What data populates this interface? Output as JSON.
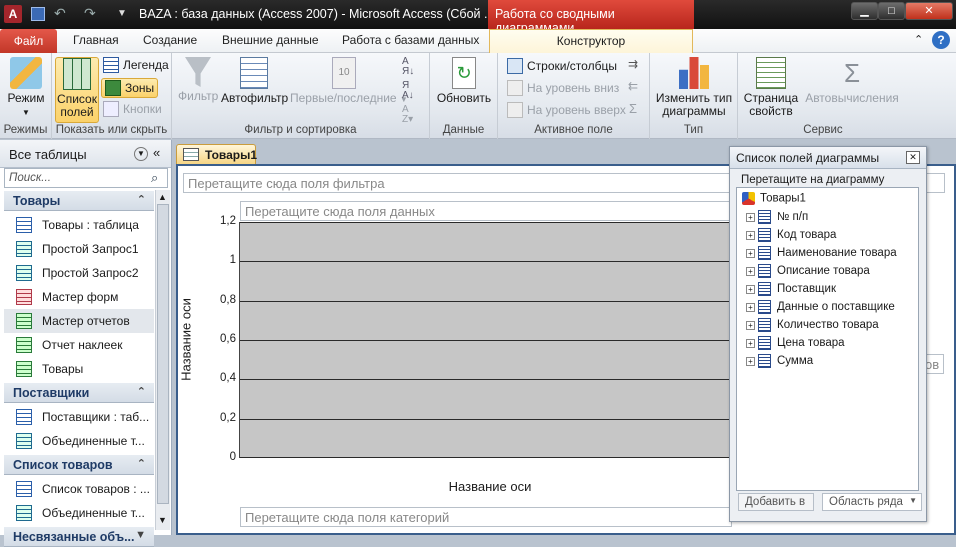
{
  "window": {
    "title": "BAZA : база данных (Access 2007)  -  Microsoft Access (Сбой ...",
    "context_tab": "Работа со сводными диаграммами",
    "min": "▁",
    "max": "□",
    "close": "✕"
  },
  "tabs": {
    "file": "Файл",
    "items": [
      "Главная",
      "Создание",
      "Внешние данные",
      "Работа с базами данных"
    ],
    "active": "Конструктор"
  },
  "ribbon": {
    "modes": {
      "label": "Режимы",
      "btn": "Режим"
    },
    "show": {
      "label": "Показать или скрыть",
      "btn1": "Список",
      "btn2": "полей",
      "legend": "Легенда",
      "zones": "Зоны",
      "buttons": "Кнопки"
    },
    "filter": {
      "label": "Фильтр и сортировка",
      "filter": "Фильтр",
      "autofilter": "Автофильтр",
      "top": "Первые/последние"
    },
    "data": {
      "label": "Данные",
      "refresh": "Обновить"
    },
    "field": {
      "label": "Активное поле",
      "rowscols": "Строки/столбцы",
      "down": "На уровень вниз",
      "up": "На уровень вверх"
    },
    "type": {
      "label": "Тип",
      "btn1": "Изменить тип",
      "btn2": "диаграммы"
    },
    "service": {
      "label": "Сервис",
      "props1": "Страница",
      "props2": "свойств",
      "autocalc": "Автовычисления"
    }
  },
  "nav": {
    "header": "Все таблицы",
    "search_placeholder": "Поиск...",
    "groups": [
      {
        "title": "Товары",
        "items": [
          "Товары : таблица",
          "Простой Запрос1",
          "Простой Запрос2",
          "Мастер форм",
          "Мастер отчетов",
          "Отчет наклеек",
          "Товары"
        ]
      },
      {
        "title": "Поставщики",
        "items": [
          "Поставщики : таб...",
          "Объединенные т..."
        ]
      },
      {
        "title": "Список товаров",
        "items": [
          "Список товаров : ...",
          "Объединенные т..."
        ]
      },
      {
        "title": "Несвязанные объ..."
      }
    ]
  },
  "document": {
    "tab": "Товары1",
    "filter_drop": "Перетащите сюда поля фильтра",
    "data_drop": "Перетащите сюда поля данных",
    "category_drop": "Перетащите сюда поля категорий",
    "series_drop_fragment": "ов"
  },
  "chart_data": {
    "type": "bar",
    "categories": [],
    "series": [],
    "xlabel": "Название оси",
    "ylabel": "Название оси",
    "ylim": [
      0,
      1.2
    ],
    "yticks": [
      "0",
      "0,2",
      "0,4",
      "0,6",
      "0,8",
      "1",
      "1,2"
    ],
    "grid": true
  },
  "fieldlist": {
    "title": "Список полей диаграммы",
    "hint": "Перетащите на диаграмму",
    "root": "Товары1",
    "fields": [
      "№ п/п",
      "Код товара",
      "Наименование товара",
      "Описание товара",
      "Поставщик",
      "Данные о поставщике",
      "Количество товара",
      "Цена товара",
      "Сумма"
    ],
    "add_btn": "Добавить в",
    "area_select": "Область ряда"
  }
}
